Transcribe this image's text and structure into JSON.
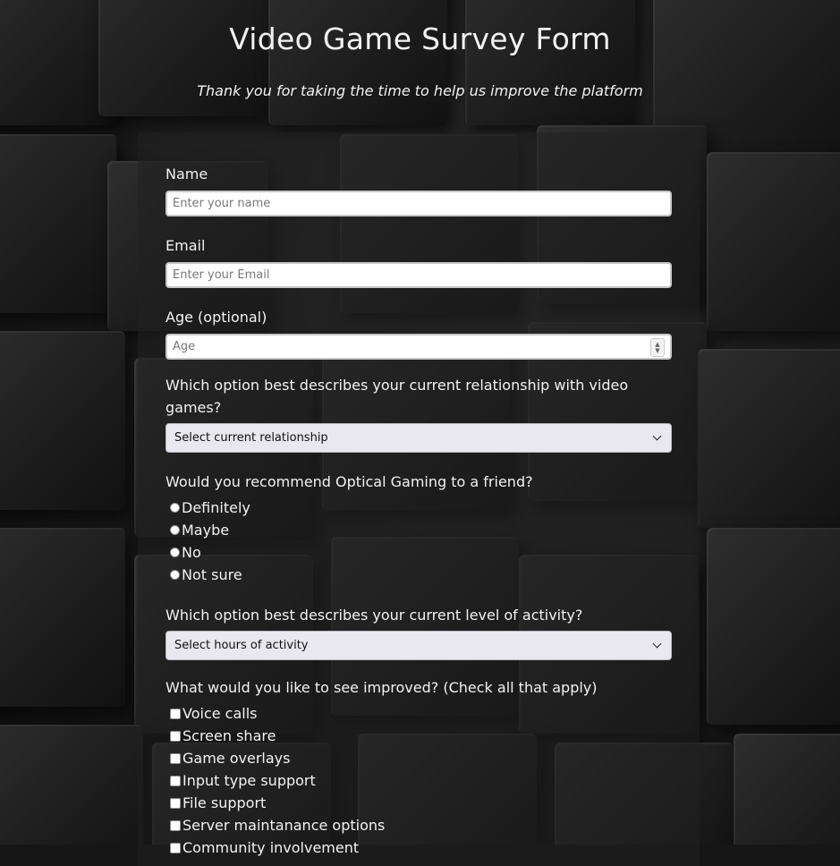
{
  "header": {
    "title": "Video Game Survey Form",
    "subtitle": "Thank you for taking the time to help us improve the platform"
  },
  "form": {
    "name": {
      "label": "Name",
      "placeholder": "Enter your name"
    },
    "email": {
      "label": "Email",
      "placeholder": "Enter your Email"
    },
    "age": {
      "label": "Age (optional)",
      "placeholder": "Age"
    },
    "relationship": {
      "label": "Which option best describes your current relationship with video games?",
      "selected": "Select current relationship"
    },
    "recommend": {
      "label": "Would you recommend Optical Gaming to a friend?",
      "options": [
        "Definitely",
        "Maybe",
        "No",
        "Not sure"
      ]
    },
    "activity": {
      "label": "Which option best describes your current level of activity?",
      "selected": "Select hours of activity"
    },
    "improvements": {
      "label": "What would you like to see improved? (Check all that apply)",
      "options": [
        "Voice calls",
        "Screen share",
        "Game overlays",
        "Input type support",
        "File support",
        "Server maintanance options",
        "Community involvement"
      ]
    }
  }
}
